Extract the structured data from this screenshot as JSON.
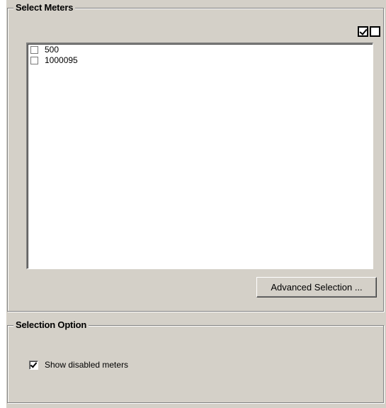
{
  "select_meters": {
    "title": "Select Meters",
    "check_all_icon": "checked-box-icon",
    "uncheck_all_icon": "unchecked-box-icon",
    "items": [
      {
        "label": "500",
        "checked": false
      },
      {
        "label": "1000095",
        "checked": false
      }
    ],
    "advanced_button_label": "Advanced Selection ..."
  },
  "selection_option": {
    "title": "Selection Option",
    "show_disabled_label": "Show disabled meters",
    "show_disabled_checked": true
  }
}
